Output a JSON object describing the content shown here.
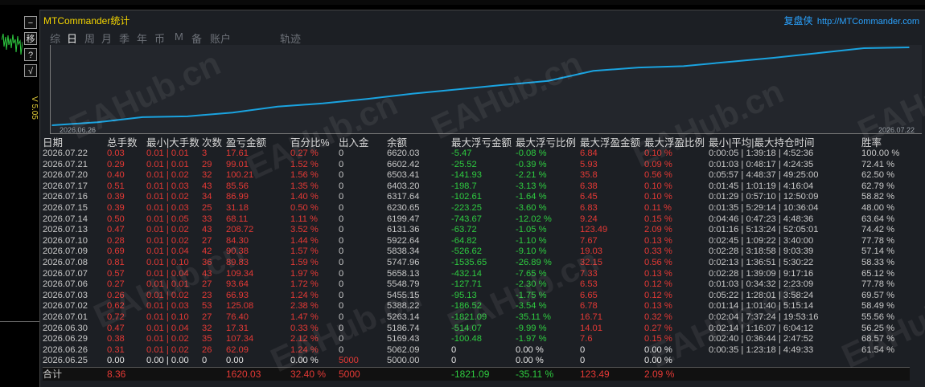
{
  "app": {
    "title": "MTCommander统计",
    "version": "V 5.05"
  },
  "brand": {
    "name": "复盘侠",
    "url": "http://MTCommander.com"
  },
  "side_buttons": [
    "−",
    "移",
    "?",
    "√"
  ],
  "tabs": [
    {
      "label": "综",
      "active": false
    },
    {
      "label": "日",
      "active": true
    },
    {
      "label": "周",
      "active": false
    },
    {
      "label": "月",
      "active": false
    },
    {
      "label": "季",
      "active": false
    },
    {
      "label": "年",
      "active": false
    },
    {
      "label": "币",
      "active": false
    },
    {
      "label": "M",
      "active": false
    },
    {
      "label": "备",
      "active": false
    },
    {
      "label": "账户",
      "active": false
    },
    {
      "label": "轨迹",
      "active": false
    }
  ],
  "watermark": "EAHub.cn",
  "chart_data": {
    "type": "line",
    "x_start_label": "2026.06.26",
    "x_end_label": "2026.07.22",
    "x": [
      "2026.06.25",
      "2026.06.26",
      "2026.06.29",
      "2026.06.30",
      "2026.07.01",
      "2026.07.02",
      "2026.07.03",
      "2026.07.06",
      "2026.07.07",
      "2026.07.08",
      "2026.07.09",
      "2026.07.10",
      "2026.07.13",
      "2026.07.14",
      "2026.07.15",
      "2026.07.16",
      "2026.07.17",
      "2026.07.20",
      "2026.07.21",
      "2026.07.22"
    ],
    "values": [
      5000.0,
      5062.09,
      5169.43,
      5186.74,
      5263.14,
      5388.22,
      5455.15,
      5548.79,
      5658.13,
      5747.96,
      5838.34,
      5922.64,
      6131.36,
      6199.47,
      6230.65,
      6317.64,
      6403.2,
      6503.41,
      6602.42,
      6620.03
    ],
    "color": "#1aa3e0"
  },
  "table": {
    "headers": [
      "日期",
      "总手数",
      "最小|大手数",
      "次数",
      "盈亏金额",
      "百分比%",
      "出入金",
      "余额",
      "最大浮亏金额",
      "最大浮亏比例",
      "最大浮盈金额",
      "最大浮盈比例",
      "最小|平均|最大持仓时间",
      "胜率"
    ],
    "rows": [
      [
        "2026.07.22",
        "0.03",
        "0.01 | 0.01",
        "3",
        "17.61",
        "0.27 %",
        "0",
        "6620.03",
        "-5.47",
        "-0.08 %",
        "6.84",
        "0.10 %",
        "0:00:05 | 1:39:18 | 4:52:36",
        "100.00 %"
      ],
      [
        "2026.07.21",
        "0.29",
        "0.01 | 0.01",
        "29",
        "99.01",
        "1.52 %",
        "0",
        "6602.42",
        "-25.52",
        "-0.39 %",
        "5.93",
        "0.09 %",
        "0:01:03 | 0:48:17 | 4:24:35",
        "72.41 %"
      ],
      [
        "2026.07.20",
        "0.40",
        "0.01 | 0.02",
        "32",
        "100.21",
        "1.56 %",
        "0",
        "6503.41",
        "-141.93",
        "-2.21 %",
        "35.8",
        "0.56 %",
        "0:05:57 | 4:48:37 | 49:25:00",
        "62.50 %"
      ],
      [
        "2026.07.17",
        "0.51",
        "0.01 | 0.03",
        "43",
        "85.56",
        "1.35 %",
        "0",
        "6403.20",
        "-198.7",
        "-3.13 %",
        "6.38",
        "0.10 %",
        "0:01:45 | 1:01:19 | 4:16:04",
        "62.79 %"
      ],
      [
        "2026.07.16",
        "0.39",
        "0.01 | 0.02",
        "34",
        "86.99",
        "1.40 %",
        "0",
        "6317.64",
        "-102.61",
        "-1.64 %",
        "6.45",
        "0.10 %",
        "0:01:29 | 0:57:10 | 12:50:09",
        "58.82 %"
      ],
      [
        "2026.07.15",
        "0.39",
        "0.01 | 0.03",
        "25",
        "31.18",
        "0.50 %",
        "0",
        "6230.65",
        "-223.25",
        "-3.60 %",
        "6.83",
        "0.11 %",
        "0:01:35 | 5:29:14 | 10:36:04",
        "48.00 %"
      ],
      [
        "2026.07.14",
        "0.50",
        "0.01 | 0.05",
        "33",
        "68.11",
        "1.11 %",
        "0",
        "6199.47",
        "-743.67",
        "-12.02 %",
        "9.24",
        "0.15 %",
        "0:04:46 | 0:47:23 | 4:48:36",
        "63.64 %"
      ],
      [
        "2026.07.13",
        "0.47",
        "0.01 | 0.02",
        "43",
        "208.72",
        "3.52 %",
        "0",
        "6131.36",
        "-63.72",
        "-1.05 %",
        "123.49",
        "2.09 %",
        "0:01:16 | 5:13:24 | 52:05:01",
        "74.42 %"
      ],
      [
        "2026.07.10",
        "0.28",
        "0.01 | 0.02",
        "27",
        "84.30",
        "1.44 %",
        "0",
        "5922.64",
        "-64.82",
        "-1.10 %",
        "7.67",
        "0.13 %",
        "0:02:45 | 1:09:22 | 3:40:00",
        "77.78 %"
      ],
      [
        "2026.07.09",
        "0.69",
        "0.01 | 0.04",
        "42",
        "90.38",
        "1.57 %",
        "0",
        "5838.34",
        "-526.62",
        "-9.10 %",
        "19.03",
        "0.33 %",
        "0:02:28 | 3:18:58 | 9:03:39",
        "57.14 %"
      ],
      [
        "2026.07.08",
        "0.81",
        "0.01 | 0.10",
        "36",
        "89.83",
        "1.59 %",
        "0",
        "5747.96",
        "-1535.65",
        "-26.89 %",
        "32.15",
        "0.56 %",
        "0:02:13 | 1:36:51 | 5:30:22",
        "58.33 %"
      ],
      [
        "2026.07.07",
        "0.57",
        "0.01 | 0.04",
        "43",
        "109.34",
        "1.97 %",
        "0",
        "5658.13",
        "-432.14",
        "-7.65 %",
        "7.33",
        "0.13 %",
        "0:02:28 | 1:39:09 | 9:17:16",
        "65.12 %"
      ],
      [
        "2026.07.06",
        "0.27",
        "0.01 | 0.01",
        "27",
        "93.64",
        "1.72 %",
        "0",
        "5548.79",
        "-127.71",
        "-2.30 %",
        "6.53",
        "0.12 %",
        "0:01:03 | 0:34:32 | 2:23:09",
        "77.78 %"
      ],
      [
        "2026.07.03",
        "0.26",
        "0.01 | 0.02",
        "23",
        "66.93",
        "1.24 %",
        "0",
        "5455.15",
        "-95.13",
        "-1.75 %",
        "6.65",
        "0.12 %",
        "0:05:22 | 1:28:01 | 3:58:24",
        "69.57 %"
      ],
      [
        "2026.07.02",
        "0.62",
        "0.01 | 0.03",
        "53",
        "125.08",
        "2.38 %",
        "0",
        "5388.22",
        "-186.52",
        "-3.54 %",
        "6.78",
        "0.13 %",
        "0:01:14 | 1:01:40 | 5:15:14",
        "58.49 %"
      ],
      [
        "2026.07.01",
        "0.72",
        "0.01 | 0.10",
        "27",
        "76.40",
        "1.47 %",
        "0",
        "5263.14",
        "-1821.09",
        "-35.11 %",
        "16.71",
        "0.32 %",
        "0:02:04 | 7:37:24 | 19:53:16",
        "55.56 %"
      ],
      [
        "2026.06.30",
        "0.47",
        "0.01 | 0.04",
        "32",
        "17.31",
        "0.33 %",
        "0",
        "5186.74",
        "-514.07",
        "-9.99 %",
        "14.01",
        "0.27 %",
        "0:02:14 | 1:16:07 | 6:04:12",
        "56.25 %"
      ],
      [
        "2026.06.29",
        "0.38",
        "0.01 | 0.02",
        "35",
        "107.34",
        "2.12 %",
        "0",
        "5169.43",
        "-100.48",
        "-1.97 %",
        "7.6",
        "0.15 %",
        "0:02:40 | 0:36:44 | 2:47:52",
        "68.57 %"
      ],
      [
        "2026.06.26",
        "0.31",
        "0.01 | 0.02",
        "26",
        "62.09",
        "1.24 %",
        "0",
        "5062.09",
        "0",
        "0.00 %",
        "0",
        "0.00 %",
        "0:00:35 | 1:23:18 | 4:49:33",
        "61.54 %"
      ],
      [
        "2026.06.25",
        "0.00",
        "0.00 | 0.00",
        "0",
        "0.00",
        "0.00 %",
        "5000",
        "5000.00",
        "0",
        "0.00 %",
        "0",
        "0.00 %",
        "",
        ""
      ]
    ],
    "total": [
      "合计",
      "8.36",
      "",
      "",
      "1620.03",
      "32.40 %",
      "5000",
      "",
      "-1821.09",
      "-35.11 %",
      "123.49",
      "2.09 %",
      "",
      ""
    ]
  }
}
